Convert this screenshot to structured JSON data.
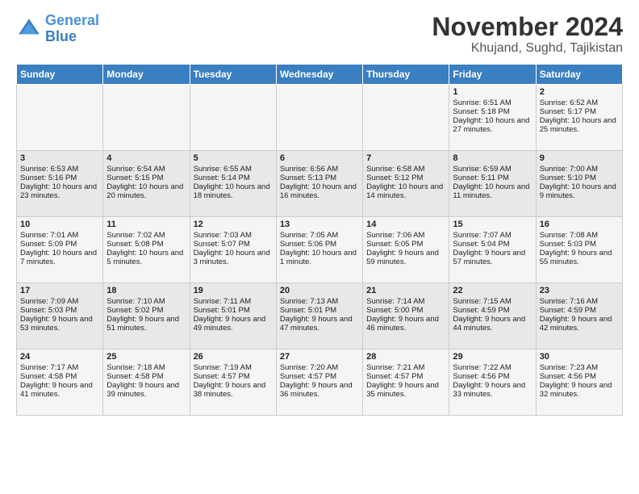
{
  "logo": {
    "line1": "General",
    "line2": "Blue"
  },
  "title": "November 2024",
  "location": "Khujand, Sughd, Tajikistan",
  "headers": [
    "Sunday",
    "Monday",
    "Tuesday",
    "Wednesday",
    "Thursday",
    "Friday",
    "Saturday"
  ],
  "weeks": [
    [
      {
        "day": "",
        "sunrise": "",
        "sunset": "",
        "daylight": ""
      },
      {
        "day": "",
        "sunrise": "",
        "sunset": "",
        "daylight": ""
      },
      {
        "day": "",
        "sunrise": "",
        "sunset": "",
        "daylight": ""
      },
      {
        "day": "",
        "sunrise": "",
        "sunset": "",
        "daylight": ""
      },
      {
        "day": "",
        "sunrise": "",
        "sunset": "",
        "daylight": ""
      },
      {
        "day": "1",
        "sunrise": "Sunrise: 6:51 AM",
        "sunset": "Sunset: 5:18 PM",
        "daylight": "Daylight: 10 hours and 27 minutes."
      },
      {
        "day": "2",
        "sunrise": "Sunrise: 6:52 AM",
        "sunset": "Sunset: 5:17 PM",
        "daylight": "Daylight: 10 hours and 25 minutes."
      }
    ],
    [
      {
        "day": "3",
        "sunrise": "Sunrise: 6:53 AM",
        "sunset": "Sunset: 5:16 PM",
        "daylight": "Daylight: 10 hours and 23 minutes."
      },
      {
        "day": "4",
        "sunrise": "Sunrise: 6:54 AM",
        "sunset": "Sunset: 5:15 PM",
        "daylight": "Daylight: 10 hours and 20 minutes."
      },
      {
        "day": "5",
        "sunrise": "Sunrise: 6:55 AM",
        "sunset": "Sunset: 5:14 PM",
        "daylight": "Daylight: 10 hours and 18 minutes."
      },
      {
        "day": "6",
        "sunrise": "Sunrise: 6:56 AM",
        "sunset": "Sunset: 5:13 PM",
        "daylight": "Daylight: 10 hours and 16 minutes."
      },
      {
        "day": "7",
        "sunrise": "Sunrise: 6:58 AM",
        "sunset": "Sunset: 5:12 PM",
        "daylight": "Daylight: 10 hours and 14 minutes."
      },
      {
        "day": "8",
        "sunrise": "Sunrise: 6:59 AM",
        "sunset": "Sunset: 5:11 PM",
        "daylight": "Daylight: 10 hours and 11 minutes."
      },
      {
        "day": "9",
        "sunrise": "Sunrise: 7:00 AM",
        "sunset": "Sunset: 5:10 PM",
        "daylight": "Daylight: 10 hours and 9 minutes."
      }
    ],
    [
      {
        "day": "10",
        "sunrise": "Sunrise: 7:01 AM",
        "sunset": "Sunset: 5:09 PM",
        "daylight": "Daylight: 10 hours and 7 minutes."
      },
      {
        "day": "11",
        "sunrise": "Sunrise: 7:02 AM",
        "sunset": "Sunset: 5:08 PM",
        "daylight": "Daylight: 10 hours and 5 minutes."
      },
      {
        "day": "12",
        "sunrise": "Sunrise: 7:03 AM",
        "sunset": "Sunset: 5:07 PM",
        "daylight": "Daylight: 10 hours and 3 minutes."
      },
      {
        "day": "13",
        "sunrise": "Sunrise: 7:05 AM",
        "sunset": "Sunset: 5:06 PM",
        "daylight": "Daylight: 10 hours and 1 minute."
      },
      {
        "day": "14",
        "sunrise": "Sunrise: 7:06 AM",
        "sunset": "Sunset: 5:05 PM",
        "daylight": "Daylight: 9 hours and 59 minutes."
      },
      {
        "day": "15",
        "sunrise": "Sunrise: 7:07 AM",
        "sunset": "Sunset: 5:04 PM",
        "daylight": "Daylight: 9 hours and 57 minutes."
      },
      {
        "day": "16",
        "sunrise": "Sunrise: 7:08 AM",
        "sunset": "Sunset: 5:03 PM",
        "daylight": "Daylight: 9 hours and 55 minutes."
      }
    ],
    [
      {
        "day": "17",
        "sunrise": "Sunrise: 7:09 AM",
        "sunset": "Sunset: 5:03 PM",
        "daylight": "Daylight: 9 hours and 53 minutes."
      },
      {
        "day": "18",
        "sunrise": "Sunrise: 7:10 AM",
        "sunset": "Sunset: 5:02 PM",
        "daylight": "Daylight: 9 hours and 51 minutes."
      },
      {
        "day": "19",
        "sunrise": "Sunrise: 7:11 AM",
        "sunset": "Sunset: 5:01 PM",
        "daylight": "Daylight: 9 hours and 49 minutes."
      },
      {
        "day": "20",
        "sunrise": "Sunrise: 7:13 AM",
        "sunset": "Sunset: 5:01 PM",
        "daylight": "Daylight: 9 hours and 47 minutes."
      },
      {
        "day": "21",
        "sunrise": "Sunrise: 7:14 AM",
        "sunset": "Sunset: 5:00 PM",
        "daylight": "Daylight: 9 hours and 46 minutes."
      },
      {
        "day": "22",
        "sunrise": "Sunrise: 7:15 AM",
        "sunset": "Sunset: 4:59 PM",
        "daylight": "Daylight: 9 hours and 44 minutes."
      },
      {
        "day": "23",
        "sunrise": "Sunrise: 7:16 AM",
        "sunset": "Sunset: 4:59 PM",
        "daylight": "Daylight: 9 hours and 42 minutes."
      }
    ],
    [
      {
        "day": "24",
        "sunrise": "Sunrise: 7:17 AM",
        "sunset": "Sunset: 4:58 PM",
        "daylight": "Daylight: 9 hours and 41 minutes."
      },
      {
        "day": "25",
        "sunrise": "Sunrise: 7:18 AM",
        "sunset": "Sunset: 4:58 PM",
        "daylight": "Daylight: 9 hours and 39 minutes."
      },
      {
        "day": "26",
        "sunrise": "Sunrise: 7:19 AM",
        "sunset": "Sunset: 4:57 PM",
        "daylight": "Daylight: 9 hours and 38 minutes."
      },
      {
        "day": "27",
        "sunrise": "Sunrise: 7:20 AM",
        "sunset": "Sunset: 4:57 PM",
        "daylight": "Daylight: 9 hours and 36 minutes."
      },
      {
        "day": "28",
        "sunrise": "Sunrise: 7:21 AM",
        "sunset": "Sunset: 4:57 PM",
        "daylight": "Daylight: 9 hours and 35 minutes."
      },
      {
        "day": "29",
        "sunrise": "Sunrise: 7:22 AM",
        "sunset": "Sunset: 4:56 PM",
        "daylight": "Daylight: 9 hours and 33 minutes."
      },
      {
        "day": "30",
        "sunrise": "Sunrise: 7:23 AM",
        "sunset": "Sunset: 4:56 PM",
        "daylight": "Daylight: 9 hours and 32 minutes."
      }
    ]
  ]
}
